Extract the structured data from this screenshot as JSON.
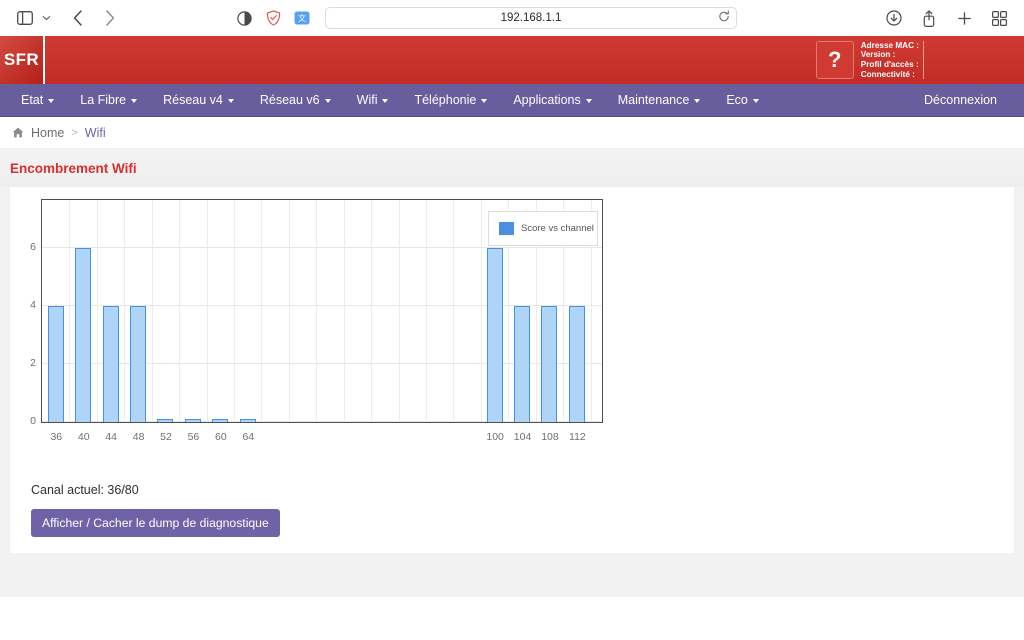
{
  "browser": {
    "address_value": "192.168.1.1",
    "icons": {
      "sidebar": "sidebar-toggle-icon",
      "sidebar_chevron": "chevron-down-icon",
      "back": "back-arrow-icon",
      "forward": "forward-arrow-icon",
      "reader": "reader-mode-icon",
      "shield": "shield-privacy-icon",
      "translate": "translate-icon",
      "reload": "reload-icon",
      "downloads": "downloads-icon",
      "share": "share-icon",
      "new_tab": "plus-icon",
      "tab_overview": "tab-overview-icon"
    }
  },
  "header": {
    "logo_text": "SFR",
    "help_label": "?",
    "info_lines": [
      "Adresse MAC :",
      "Version :",
      "Profil d'accès :",
      "Connectivité :"
    ]
  },
  "nav": {
    "items": [
      {
        "label": "Etat",
        "has_caret": true
      },
      {
        "label": "La Fibre",
        "has_caret": true
      },
      {
        "label": "Réseau v4",
        "has_caret": true
      },
      {
        "label": "Réseau v6",
        "has_caret": true
      },
      {
        "label": "Wifi",
        "has_caret": true
      },
      {
        "label": "Téléphonie",
        "has_caret": true
      },
      {
        "label": "Applications",
        "has_caret": true
      },
      {
        "label": "Maintenance",
        "has_caret": true
      },
      {
        "label": "Eco",
        "has_caret": true
      }
    ],
    "logout_label": "Déconnexion"
  },
  "breadcrumb": {
    "home_label": "Home",
    "separator": ">",
    "current_label": "Wifi"
  },
  "page": {
    "title": "Encombrement Wifi",
    "canal_actuel": "Canal actuel: 36/80",
    "dump_button_label": "Afficher / Cacher le dump de diagnostique"
  },
  "colors": {
    "brand_red": "#c22c26",
    "nav_purple": "#685e9e",
    "title_red": "#d83030",
    "bar_fill": "#aed4f7",
    "bar_stroke": "#4a90e2",
    "button_purple": "#6f62a6"
  },
  "chart_data": {
    "type": "bar",
    "title": "",
    "xlabel": "",
    "ylabel": "",
    "ylim": [
      0,
      7.6
    ],
    "yticks": [
      0,
      2,
      4,
      6
    ],
    "grid": true,
    "legend": {
      "position": "top-right",
      "entries": [
        "Score vs channel"
      ]
    },
    "categories": [
      36,
      40,
      44,
      48,
      52,
      56,
      60,
      64,
      100,
      104,
      108,
      112
    ],
    "tick_labels": [
      "36",
      "40",
      "44",
      "48",
      "52",
      "56",
      "60",
      "64",
      "100",
      "104",
      "108",
      "112"
    ],
    "values": [
      4,
      6,
      4,
      4,
      0.07,
      0.07,
      0.07,
      0.07,
      6,
      4,
      4,
      4
    ],
    "series": [
      {
        "name": "Score vs channel",
        "values": [
          4,
          6,
          4,
          4,
          0.07,
          0.07,
          0.07,
          0.07,
          6,
          4,
          4,
          4
        ]
      }
    ]
  }
}
